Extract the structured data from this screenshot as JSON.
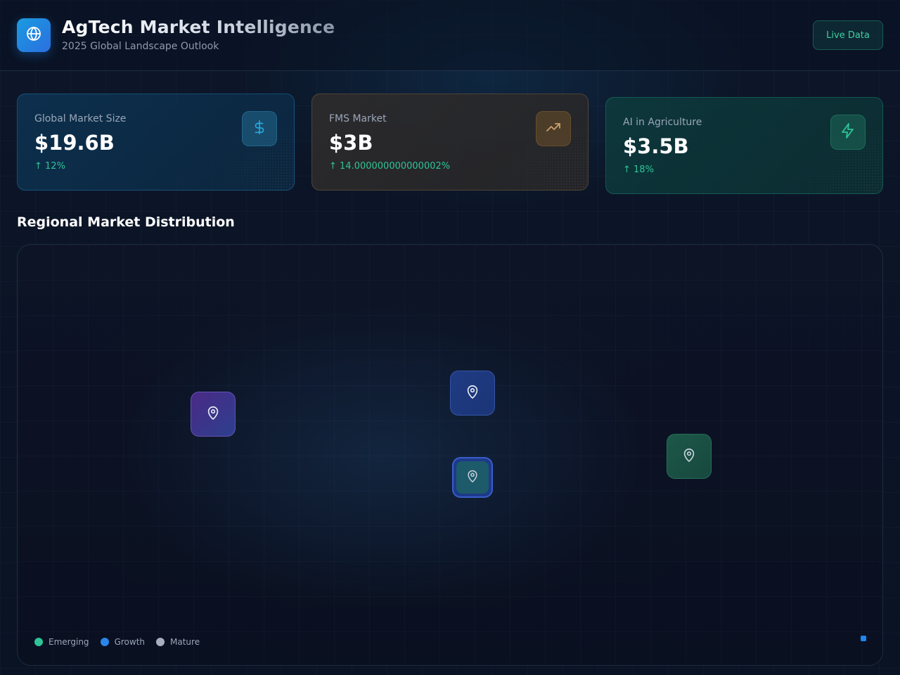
{
  "header": {
    "title": "AgTech Market Intelligence",
    "subtitle": "2025 Global Landscape Outlook",
    "logo_icon": "globe-icon",
    "live_button_label": "Live Data"
  },
  "metrics": [
    {
      "label": "Global Market Size",
      "value": "$19.6B",
      "change": "↑ 12%",
      "icon": "dollar-icon",
      "accent": "#2aa8e0"
    },
    {
      "label": "FMS Market",
      "value": "$3B",
      "change": "↑ 14.000000000000002%",
      "icon": "trending-up-icon",
      "accent": "#c9a26a"
    },
    {
      "label": "AI in Agriculture",
      "value": "$3.5B",
      "change": "↑ 18%",
      "icon": "zap-icon",
      "accent": "#2fc497"
    }
  ],
  "map": {
    "section_title": "Regional Market Distribution",
    "markers": [
      {
        "icon": "map-pin-icon"
      },
      {
        "icon": "map-pin-icon"
      },
      {
        "icon": "map-pin-icon"
      },
      {
        "icon": "map-pin-icon"
      }
    ],
    "legend": [
      {
        "label": "Emerging",
        "color": "#2fc497"
      },
      {
        "label": "Growth",
        "color": "#2a86e8"
      },
      {
        "label": "Mature",
        "color": "#a8b0c0"
      }
    ]
  },
  "colors": {
    "background": "#0b1426",
    "positive": "#2fc497",
    "brand": "#1a9be0"
  }
}
